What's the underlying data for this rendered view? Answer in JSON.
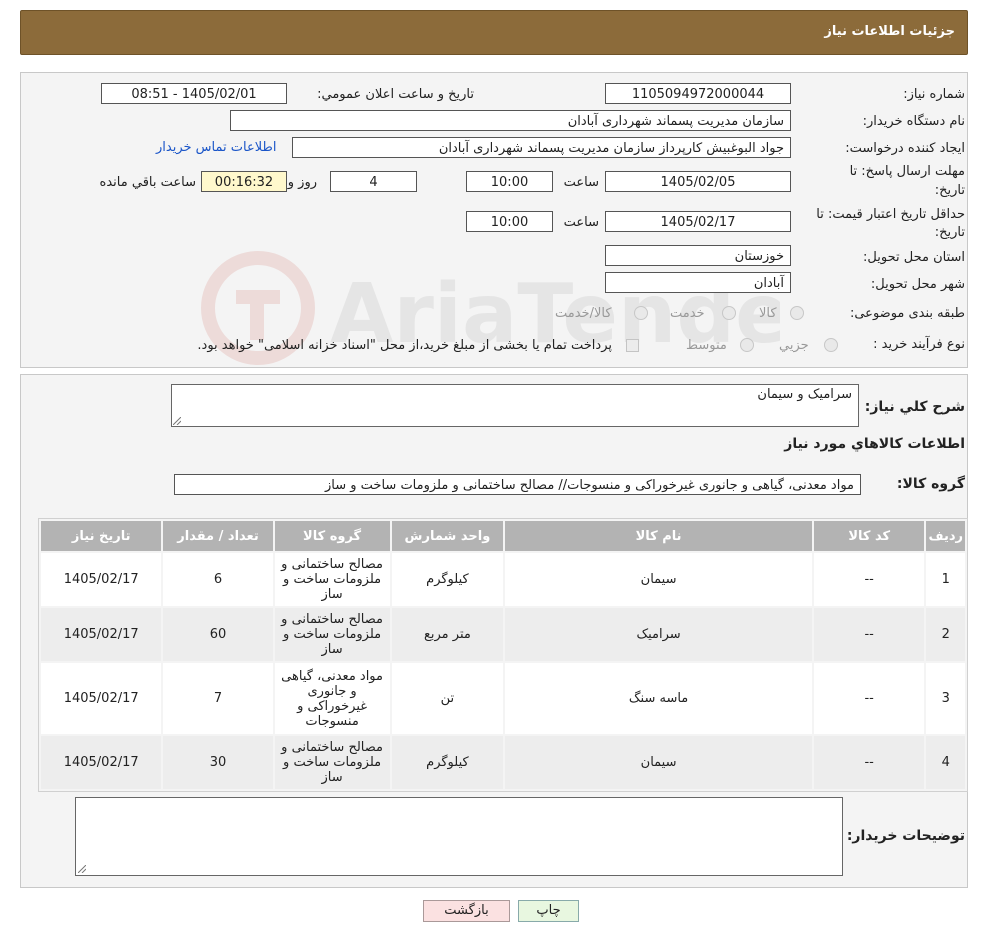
{
  "header": {
    "title": "جزئیات اطلاعات نیاز"
  },
  "form": {
    "need_number_label": "شماره نیاز:",
    "need_number": "1105094972000044",
    "announce_label": "تاریخ و ساعت اعلان عمومي:",
    "announce_value": "1405/02/01 - 08:51",
    "buyer_org_label": "نام دستگاه خریدار:",
    "buyer_org": "سازمان مدیریت پسماند شهرداری آبادان",
    "requester_label": "ایجاد کننده درخواست:",
    "requester": "جواد البوغبیش کارپرداز سازمان مدیریت پسماند شهرداری آبادان",
    "contact_link": "اطلاعات تماس خریدار",
    "deadline_label_1": "مهلت ارسال پاسخ: تا",
    "deadline_label_2": "تاریخ:",
    "deadline_date": "1405/02/05",
    "hour_label": "ساعت",
    "deadline_time": "10:00",
    "days_value": "4",
    "days_label": "روز و",
    "remaining_time": "00:16:32",
    "remaining_label": "ساعت باقي مانده",
    "validity_label_1": "حداقل تاریخ اعتبار قیمت: تا",
    "validity_label_2": "تاریخ:",
    "validity_date": "1405/02/17",
    "validity_time": "10:00",
    "province_label": "استان محل تحویل:",
    "province": "خوزستان",
    "city_label": "شهر محل تحویل:",
    "city": "آبادان",
    "category_label": "طبقه بندی موضوعی:",
    "category_options": [
      "کالا",
      "خدمت",
      "کالا/خدمت"
    ],
    "process_label": "نوع فرآیند خرید :",
    "process_options": [
      "جزيي",
      "متوسط"
    ],
    "process_note": "پرداخت تمام یا بخشی از مبلغ خرید،از محل \"اسناد خزانه اسلامی\" خواهد بود."
  },
  "summary": {
    "desc_label": "شرح کلي نیاز:",
    "desc_value": "سرامیک و سیمان",
    "items_title": "اطلاعات کالاهاي مورد نیاز",
    "group_label": "گروه کالا:",
    "group_value": "مواد معدنی، گیاهی و جانوری غیرخوراکی و منسوجات// مصالح ساختمانی و ملزومات ساخت و ساز"
  },
  "table": {
    "headers": [
      "ردیف",
      "کد کالا",
      "نام کالا",
      "واحد شمارش",
      "گروه کالا",
      "تعداد / مقدار",
      "تاریخ نیاز"
    ],
    "rows": [
      [
        "1",
        "--",
        "سیمان",
        "کیلوگرم",
        "مصالح ساختمانی و ملزومات ساخت و ساز",
        "6",
        "1405/02/17"
      ],
      [
        "2",
        "--",
        "سرامیک",
        "متر مربع",
        "مصالح ساختمانی و ملزومات ساخت و ساز",
        "60",
        "1405/02/17"
      ],
      [
        "3",
        "--",
        "ماسه سنگ",
        "تن",
        "مواد معدنی، گیاهی و جانوری غیرخوراکی و منسوجات",
        "7",
        "1405/02/17"
      ],
      [
        "4",
        "--",
        "سیمان",
        "کیلوگرم",
        "مصالح ساختمانی و ملزومات ساخت و ساز",
        "30",
        "1405/02/17"
      ]
    ]
  },
  "notes": {
    "label": "توضیحات خریدار:",
    "value": ""
  },
  "buttons": {
    "print": "چاپ",
    "back": "بازگشت"
  },
  "colors": {
    "header_bg": "#8c6b3a",
    "link": "#1a55c8",
    "table_header": "#b3b3b3",
    "remaining_bg": "#fff8cc"
  }
}
